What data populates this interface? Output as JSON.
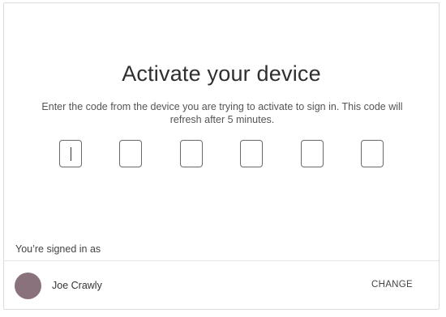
{
  "dialog": {
    "title": "Activate your device",
    "instructions": "Enter the code from the device you are trying to activate to sign in. This code will refresh after 5 minutes.",
    "code_inputs": [
      {
        "value": "",
        "focused": true
      },
      {
        "value": "",
        "focused": false
      },
      {
        "value": "",
        "focused": false
      },
      {
        "value": "",
        "focused": false
      },
      {
        "value": "",
        "focused": false
      },
      {
        "value": "",
        "focused": false
      }
    ]
  },
  "account": {
    "signed_in_label": "You’re signed in as",
    "user_name": "Joe Crawly",
    "change_label": "CHANGE",
    "avatar_color": "#8a727c"
  }
}
